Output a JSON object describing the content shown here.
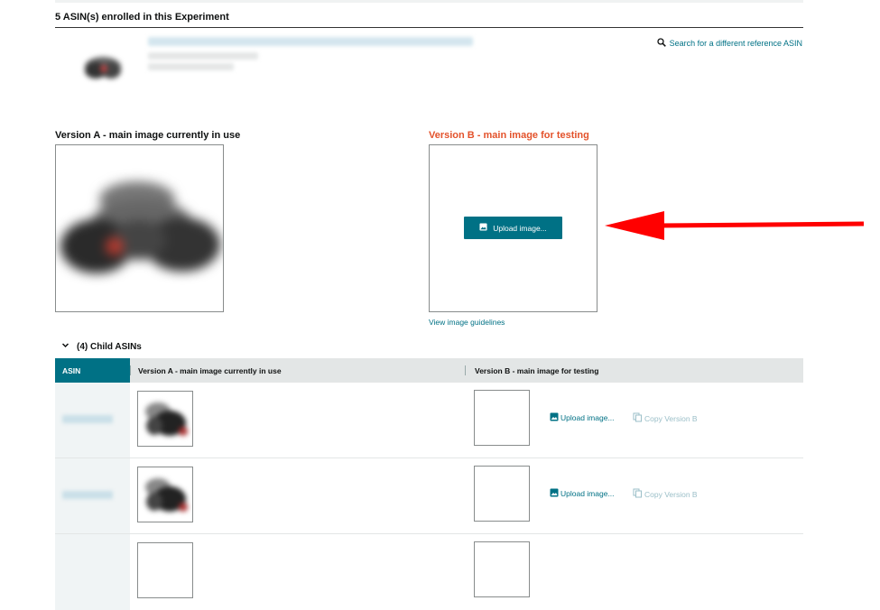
{
  "experiment": {
    "enrolled_title": "5 ASIN(s) enrolled in this Experiment",
    "search_link": "Search for a different reference ASIN",
    "icons": {
      "search": "search-icon"
    }
  },
  "versions": {
    "a_title": "Version A - main image currently in use",
    "b_title": "Version B - main image for testing",
    "upload_button": "Upload image...",
    "guidelines_link": "View image guidelines"
  },
  "child_asins": {
    "header": "(4) Child ASINs",
    "columns": [
      "ASIN",
      "Version A - main image currently in use",
      "Version B - main image for testing"
    ],
    "rows": [
      {
        "asin": "",
        "upload_label": "Upload image...",
        "copy_label": "Copy Version B"
      },
      {
        "asin": "",
        "upload_label": "Upload image...",
        "copy_label": "Copy Version B"
      }
    ]
  },
  "colors": {
    "accent": "#007185",
    "version_b_title": "#e3522b",
    "arrow": "#ff0000"
  }
}
